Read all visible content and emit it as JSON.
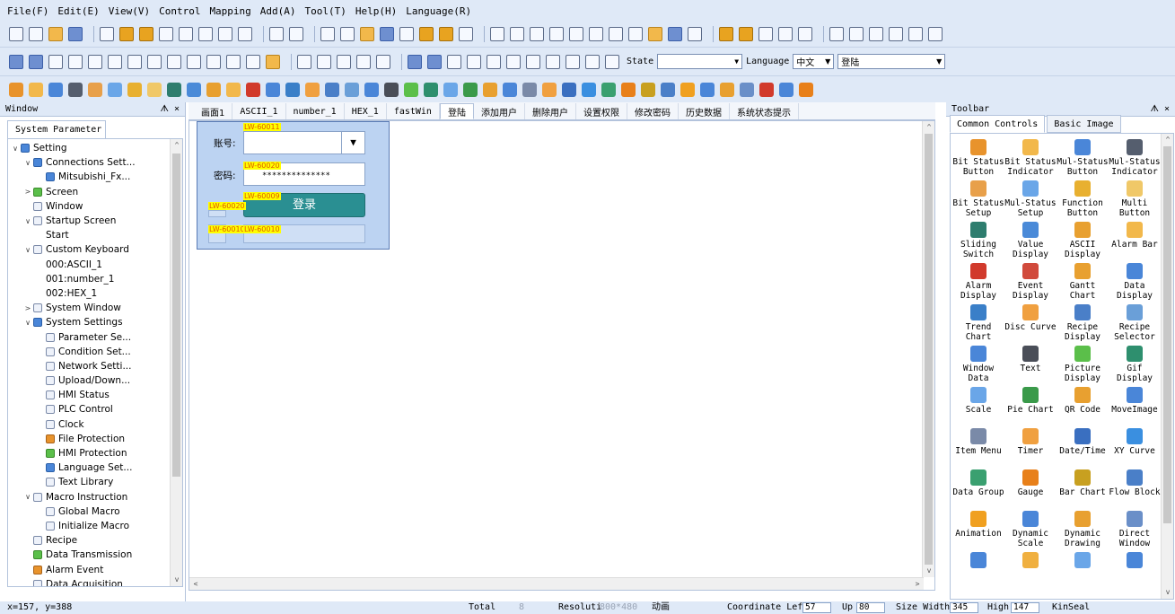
{
  "menu": [
    "File(F)",
    "Edit(E)",
    "View(V)",
    "Control",
    "Mapping",
    "Add(A)",
    "Tool(T)",
    "Help(H)",
    "Language(R)"
  ],
  "toolbar2": {
    "state_label": "State",
    "state_value": "",
    "language_label": "Language",
    "language_value": "中文",
    "screen_value": "登陆"
  },
  "window_panel": {
    "title": "Window",
    "close_glyph": "ᗑ ×",
    "tab": "System Parameter",
    "tree": [
      {
        "label": "Setting",
        "level": 0,
        "arrow": "v",
        "icon": "b"
      },
      {
        "label": "Connections Sett...",
        "level": 1,
        "arrow": "v",
        "icon": "b"
      },
      {
        "label": "Mitsubishi_Fx...",
        "level": 2,
        "arrow": "",
        "icon": "b"
      },
      {
        "label": "Screen",
        "level": 1,
        "arrow": ">",
        "icon": "g"
      },
      {
        "label": "Window",
        "level": 1,
        "arrow": "",
        "icon": ""
      },
      {
        "label": "Startup Screen",
        "level": 1,
        "arrow": "v",
        "icon": ""
      },
      {
        "label": "Start",
        "level": 2,
        "arrow": "",
        "icon": "none"
      },
      {
        "label": "Custom Keyboard",
        "level": 1,
        "arrow": "v",
        "icon": ""
      },
      {
        "label": "000:ASCII_1",
        "level": 2,
        "arrow": "",
        "icon": "none"
      },
      {
        "label": "001:number_1",
        "level": 2,
        "arrow": "",
        "icon": "none"
      },
      {
        "label": "002:HEX_1",
        "level": 2,
        "arrow": "",
        "icon": "none"
      },
      {
        "label": "System Window",
        "level": 1,
        "arrow": ">",
        "icon": ""
      },
      {
        "label": "System Settings",
        "level": 1,
        "arrow": "v",
        "icon": "b"
      },
      {
        "label": "Parameter Se...",
        "level": 2,
        "arrow": "",
        "icon": ""
      },
      {
        "label": "Condition Set...",
        "level": 2,
        "arrow": "",
        "icon": ""
      },
      {
        "label": "Network Setti...",
        "level": 2,
        "arrow": "",
        "icon": ""
      },
      {
        "label": "Upload/Down...",
        "level": 2,
        "arrow": "",
        "icon": ""
      },
      {
        "label": "HMI Status",
        "level": 2,
        "arrow": "",
        "icon": ""
      },
      {
        "label": "PLC Control",
        "level": 2,
        "arrow": "",
        "icon": ""
      },
      {
        "label": "Clock",
        "level": 2,
        "arrow": "",
        "icon": ""
      },
      {
        "label": "File Protection",
        "level": 2,
        "arrow": "",
        "icon": "o"
      },
      {
        "label": "HMI Protection",
        "level": 2,
        "arrow": "",
        "icon": "g"
      },
      {
        "label": "Language Set...",
        "level": 2,
        "arrow": "",
        "icon": "b"
      },
      {
        "label": "Text Library",
        "level": 2,
        "arrow": "",
        "icon": ""
      },
      {
        "label": "Macro Instruction",
        "level": 1,
        "arrow": "v",
        "icon": ""
      },
      {
        "label": "Global Macro",
        "level": 2,
        "arrow": "",
        "icon": ""
      },
      {
        "label": "Initialize Macro",
        "level": 2,
        "arrow": "",
        "icon": ""
      },
      {
        "label": "Recipe",
        "level": 1,
        "arrow": "",
        "icon": ""
      },
      {
        "label": "Data Transmission",
        "level": 1,
        "arrow": "",
        "icon": "g"
      },
      {
        "label": "Alarm Event",
        "level": 1,
        "arrow": "",
        "icon": "o"
      },
      {
        "label": "Data Acquisition",
        "level": 1,
        "arrow": "",
        "icon": ""
      }
    ]
  },
  "editor_tabs": [
    "画面1",
    "ASCII_1",
    "number_1",
    "HEX_1",
    "fastWin",
    "登陆",
    "添加用户",
    "删除用户",
    "设置权限",
    "修改密码",
    "历史数据",
    "系统状态提示"
  ],
  "active_tab_index": 5,
  "login": {
    "account_label": "账号:",
    "password_label": "密码:",
    "password_mask": "**************",
    "login_button": "登录",
    "combo_arrow": "▼",
    "tag_account": "LW-60011",
    "tag_password": "LW-60020",
    "tag_button_top": "LW-60009",
    "tag_button_left": "LW-60020",
    "tag_bottom_1": "LW-60010",
    "tag_bottom_2": "LW-60010"
  },
  "toolbar_panel": {
    "title": "Toolbar",
    "close_glyph": "ᗑ ×",
    "tabs": [
      "Common Controls",
      "Basic Image"
    ],
    "items": [
      {
        "label": "Bit Status Button",
        "color": "#e8932c"
      },
      {
        "label": "Bit Status Indicator",
        "color": "#f2b84b"
      },
      {
        "label": "Mul-Status Button",
        "color": "#4a86d8"
      },
      {
        "label": "Mul-Status Indicator",
        "color": "#555e6e"
      },
      {
        "label": "Bit Status Setup",
        "color": "#e8a04a"
      },
      {
        "label": "Mul-Status Setup",
        "color": "#6aa6e8"
      },
      {
        "label": "Function Button",
        "color": "#e8b030"
      },
      {
        "label": "Multi Button",
        "color": "#f0c868"
      },
      {
        "label": "Sliding Switch",
        "color": "#2e7d6e"
      },
      {
        "label": "Value Display",
        "color": "#4a8ad8"
      },
      {
        "label": "ASCII Display",
        "color": "#e8a030"
      },
      {
        "label": "Alarm Bar",
        "color": "#f2b84b"
      },
      {
        "label": "Alarm Display",
        "color": "#d13a2c"
      },
      {
        "label": "Event Display",
        "color": "#d14a3c"
      },
      {
        "label": "Gantt Chart",
        "color": "#e8a030"
      },
      {
        "label": "Data Display",
        "color": "#4a86d8"
      },
      {
        "label": "Trend Chart",
        "color": "#3a7fc8"
      },
      {
        "label": "Disc Curve",
        "color": "#f0a040"
      },
      {
        "label": "Recipe Display",
        "color": "#4a7fc8"
      },
      {
        "label": "Recipe Selector",
        "color": "#6a9fd8"
      },
      {
        "label": "Window Data Transfer",
        "color": "#4a86d8"
      },
      {
        "label": "Text",
        "color": "#4a4e58"
      },
      {
        "label": "Picture Display",
        "color": "#5bbf4a"
      },
      {
        "label": "Gif Display",
        "color": "#2e8f6e"
      },
      {
        "label": "Scale",
        "color": "#6aa6e8"
      },
      {
        "label": "Pie Chart",
        "color": "#3a9a4a"
      },
      {
        "label": "QR Code",
        "color": "#e8a030"
      },
      {
        "label": "MoveImage",
        "color": "#4a86d8"
      },
      {
        "label": "Item Menu",
        "color": "#7a8aa8"
      },
      {
        "label": "Timer",
        "color": "#f0a040"
      },
      {
        "label": "Date/Time",
        "color": "#3a6fc0"
      },
      {
        "label": "XY Curve",
        "color": "#3a8fe0"
      },
      {
        "label": "Data Group",
        "color": "#3aa070"
      },
      {
        "label": "Gauge",
        "color": "#e8801a"
      },
      {
        "label": "Bar Chart",
        "color": "#c8a020"
      },
      {
        "label": "Flow Block",
        "color": "#4a7fc8"
      },
      {
        "label": "Animation",
        "color": "#f0a020"
      },
      {
        "label": "Dynamic Scale",
        "color": "#4a86d8"
      },
      {
        "label": "Dynamic Drawing",
        "color": "#e8a030"
      },
      {
        "label": "Direct Window",
        "color": "#6a8fc8"
      },
      {
        "label": "",
        "color": "#4a86d8"
      },
      {
        "label": "",
        "color": "#f0b040"
      },
      {
        "label": "",
        "color": "#6aa6e8"
      },
      {
        "label": "",
        "color": "#4a86d8"
      }
    ]
  },
  "status": {
    "cursor": "x=157, y=388",
    "total_label": "Total",
    "total_value": "8",
    "resolution_label": "Resoluti",
    "resolution_value": "800*480",
    "animation_label": "动画",
    "coord_left_label": "Coordinate Left",
    "coord_left_value": "57",
    "up_label": "Up",
    "up_value": "80",
    "size_width_label": "Size Width",
    "size_width_value": "345",
    "high_label": "High",
    "high_value": "147",
    "kinseal": "KinSeal"
  }
}
